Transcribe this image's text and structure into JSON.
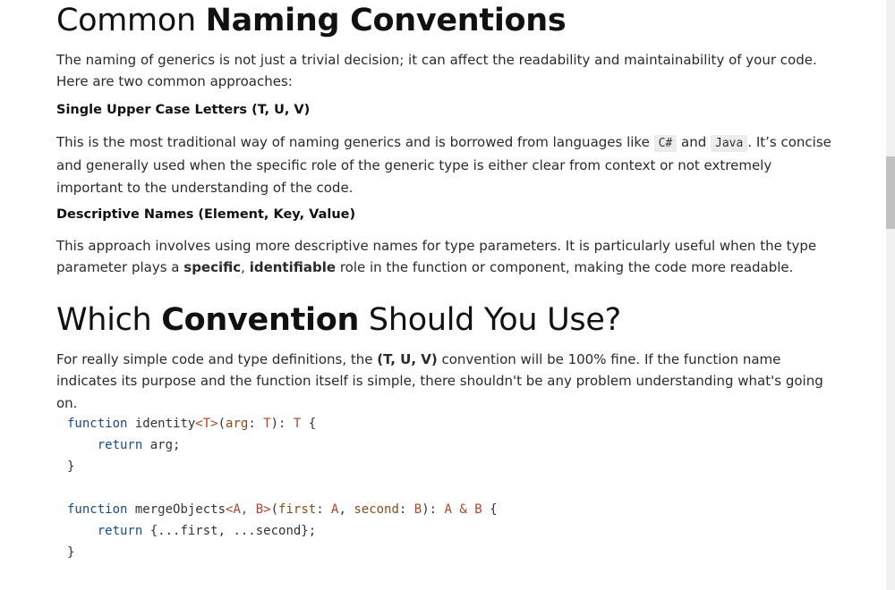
{
  "section1": {
    "heading_light": "Common",
    "heading_bold": "Naming Conventions",
    "intro": "The naming of generics is not just a trivial decision; it can affect the readability and maintainability of your code. Here are two common approaches:",
    "single": {
      "title": "Single Upper Case Letters (T, U, V)",
      "text_before": "This is the most traditional way of naming generics and is borrowed from languages like ",
      "code1": "C#",
      "text_and": " and ",
      "code2": "Java",
      "text_after": ". It’s concise and generally used when the specific role of the generic type is either clear from context or not extremely important to the understanding of the code."
    },
    "descriptive": {
      "title": "Descriptive Names (Element, Key, Value)",
      "text_before": "This approach involves using more descriptive names for type parameters. It is particularly useful when the type parameter plays a ",
      "bold1": "specific",
      "comma": ", ",
      "bold2": "identifiable",
      "text_after": " role in the function or component, making the code more readable."
    }
  },
  "section2": {
    "heading_a": "Which ",
    "heading_bold": "Convention",
    "heading_b": " Should You Use?",
    "text_before": "For really simple code and type definitions, the ",
    "bold": "(T, U, V)",
    "text_after": " convention will be 100% fine. If the function name indicates its purpose and the function itself is simple, there shouldn't be any problem understanding what's going on."
  },
  "code": {
    "l1_kw": "function",
    "l1_name": " identity",
    "l1_generic": "<T>",
    "l1_open": "(",
    "l1_param": "arg",
    "l1_colon": ": ",
    "l1_ptype": "T",
    "l1_close": "): ",
    "l1_rtype": "T",
    "l1_brace": " {",
    "l2_indent": "    ",
    "l2_kw": "return",
    "l2_rest": " arg;",
    "l3": "}",
    "l5_kw": "function",
    "l5_name": " mergeObjects",
    "l5_generic": "<A, B>",
    "l5_open": "(",
    "l5_p1": "first",
    "l5_c1": ": ",
    "l5_t1": "A",
    "l5_sep": ", ",
    "l5_p2": "second",
    "l5_c2": ": ",
    "l5_t2": "B",
    "l5_close": "): ",
    "l5_rtype": "A & B",
    "l5_brace": " {",
    "l6_indent": "    ",
    "l6_kw": "return",
    "l6_rest": " {...first, ...second};",
    "l7": "}"
  }
}
